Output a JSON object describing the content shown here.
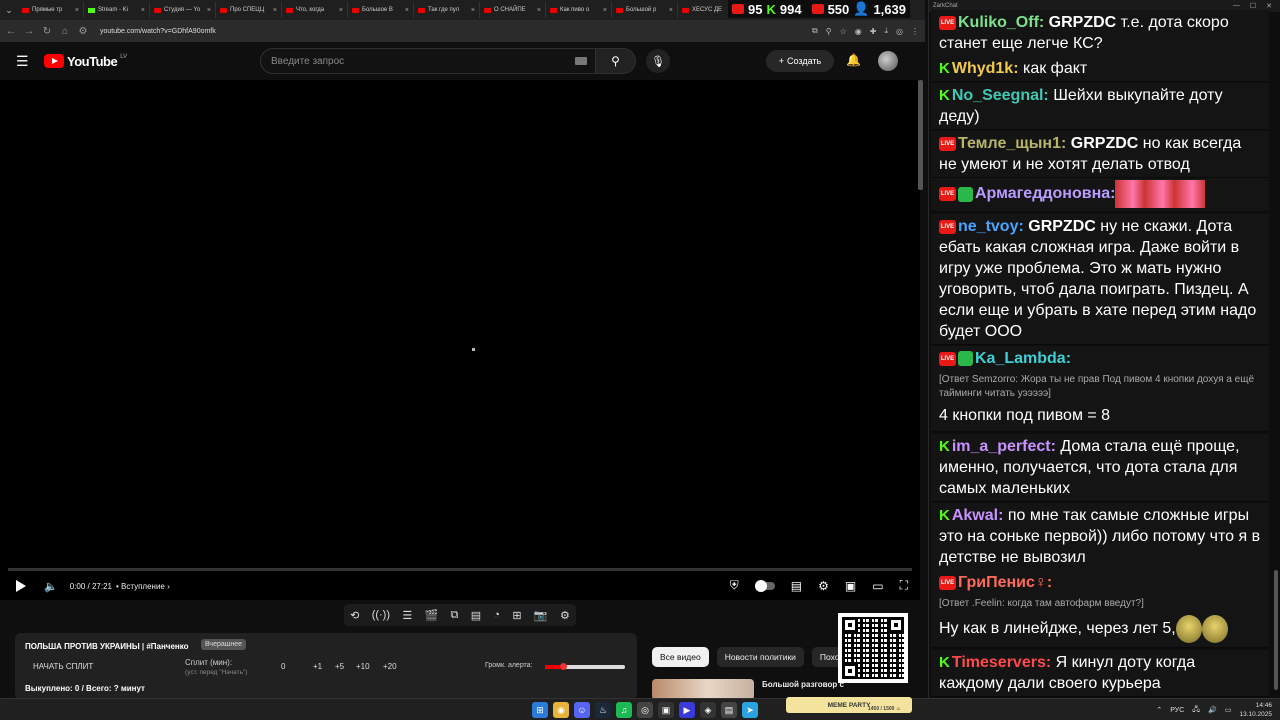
{
  "browser": {
    "tabs": [
      {
        "title": "Прямые тр",
        "icon": "youtube"
      },
      {
        "title": "Stream - Ki",
        "icon": "kick"
      },
      {
        "title": "Студия — Yo",
        "icon": "youtube"
      },
      {
        "title": "Про СПЕЦЦ",
        "icon": "youtube"
      },
      {
        "title": "Что, когда",
        "icon": "youtube"
      },
      {
        "title": "Большое В",
        "icon": "youtube"
      },
      {
        "title": "Так где пул",
        "icon": "youtube"
      },
      {
        "title": "О СНАЙПЕ",
        "icon": "youtube"
      },
      {
        "title": "Как пиво о",
        "icon": "youtube"
      },
      {
        "title": "Большой р",
        "icon": "youtube"
      },
      {
        "title": "ХЕСУС ДЕ",
        "icon": "youtube"
      }
    ],
    "url": "youtube.com/watch?v=GDhfA90omfk"
  },
  "overlay_counters": {
    "twitch": "95",
    "kick": "994",
    "live": "550",
    "total": "1,639"
  },
  "youtube": {
    "logo": "YouTube",
    "logo_country": "LV",
    "search_placeholder": "Введите запрос",
    "create_label": "Создать",
    "player": {
      "time": "0:00 / 27:21",
      "chapter": "• Вступление",
      "progress": 0
    },
    "video_title": "ПОЛЬША ПРОТИВ УКРАИНЫ | #Панченко",
    "yesterday_badge": "Вчерашнее",
    "split": {
      "start_button": "НАЧАТЬ СПЛИТ",
      "label": "Сплит (мин):",
      "hint": "(уст. перед \"Начать\")",
      "value": "0",
      "increments": [
        "+1",
        "+5",
        "+10",
        "+20"
      ],
      "alert_volume_label": "Громк. алерта:",
      "alert_volume": 0.22,
      "downloaded": "Выкуплено: 0 / Всего: ? минут"
    },
    "chips": [
      "Все видео",
      "Новости политики",
      "Похо"
    ],
    "rec_title": "Большой разговор с"
  },
  "chat": {
    "window_title": "ZarkChat",
    "messages": [
      {
        "src": "live",
        "user": "Kuliko_Off:",
        "color": "#7ee08a",
        "mention": "GRPZDC",
        "text": " т.е. дота скоро станет еще легче КС?"
      },
      {
        "src": "kick",
        "user": "Whyd1k:",
        "color": "#f2c94c",
        "text": " как факт"
      },
      {
        "src": "kick",
        "user": "No_Seegnal:",
        "color": "#3ec9b3",
        "text": " Шейхи выкупайте доту деду)"
      },
      {
        "src": "live",
        "user": "Темле_щын1:",
        "color": "#b6b46a",
        "mention": "GRPZDC",
        "text": " но как всегда не умеют и не хотят делать отвод"
      },
      {
        "src": "live",
        "user": "Армагеддоновна:",
        "color": "#b99cff",
        "mod": true,
        "emote": true
      },
      {
        "src": "live",
        "user": "ne_tvoy:",
        "color": "#4aa3ff",
        "mention": "GRPZDC",
        "text": " ну не скажи. Дота ебать какая сложная игра. Даже войти в игру уже проблема. Это ж мать нужно уговорить, чтоб дала поиграть. Пиздец. А если еще и убрать в хате перед этим надо будет ООО"
      },
      {
        "src": "live",
        "user": "Ka_Lambda:",
        "color": "#3fd0d6",
        "mod": true,
        "reply": "[Ответ Semzorro: Жора ты не прав Под пивом 4 кнопки дохуя а ещё тайминги читать уэээээ]",
        "text": "4 кнопки под пивом = 8"
      },
      {
        "src": "kick",
        "user": "im_a_perfect:",
        "color": "#c792ff",
        "text": " Дома стала ещё проще, именно, получается, что дота стала для самых маленьких"
      },
      {
        "src": "kick",
        "user": "Akwal:",
        "color": "#c792ff",
        "text": " по мне так самые сложные игры это на соньке первой)) либо потому что я в детстве не вывозил"
      },
      {
        "src": "live",
        "user": "ГриПенис♀:",
        "color": "#ff6a5a",
        "reply": "[Ответ .Feelin: когда там автофарм введут?]",
        "text": "Ну как в линейдже, через лет 5,"
      },
      {
        "src": "kick",
        "user": "Timeservers:",
        "color": "#ff4b4b",
        "text": " Я кинул доту когда каждому дали своего курьера"
      }
    ]
  },
  "taskbar": {
    "lang": "РУС",
    "time": "14:46",
    "date": "13.10.2025",
    "meme_party": "MEME PARTY",
    "meme_party_sub": "1450 / 1500 ☺"
  }
}
